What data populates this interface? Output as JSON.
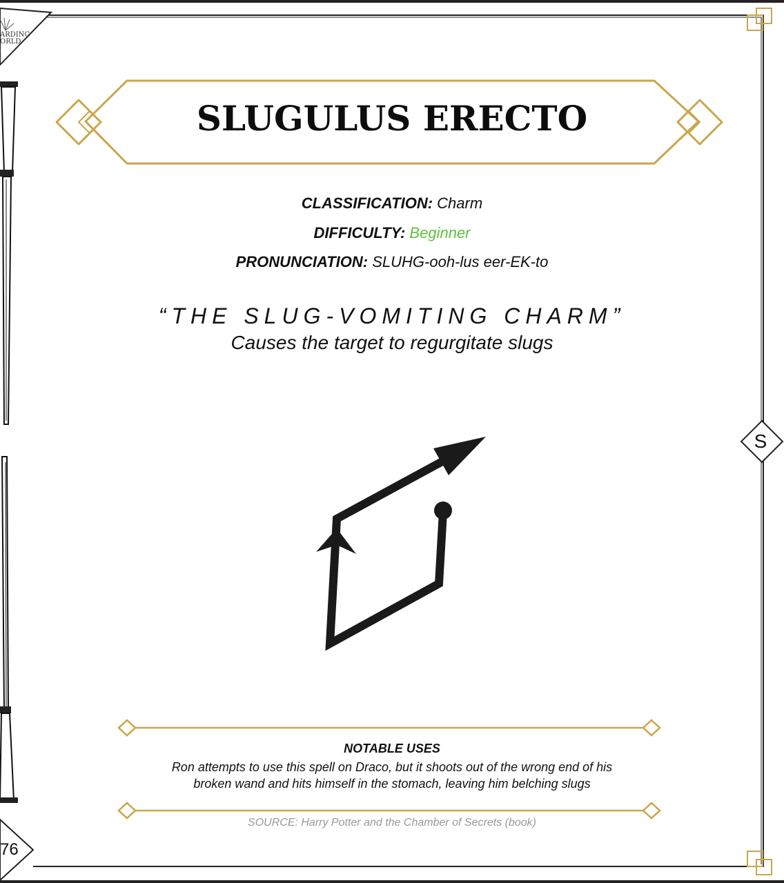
{
  "logo": {
    "line1": "ARDING",
    "line2": "ORLD"
  },
  "page_number": "76",
  "section_tab": "S",
  "spell": {
    "title": "SLUGULUS ERECTO",
    "classification_label": "CLASSIFICATION:",
    "classification_value": "Charm",
    "difficulty_label": "DIFFICULTY:",
    "difficulty_value": "Beginner",
    "pronunciation_label": "PRONUNCIATION:",
    "pronunciation_value": "SLUHG-ooh-lus eer-EK-to",
    "nickname": "“THE SLUG-VOMITING CHARM”",
    "description": "Causes the target to regurgitate slugs"
  },
  "notable": {
    "heading": "NOTABLE USES",
    "text": "Ron attempts to use this spell on Draco, but it shoots out of the wrong end of his broken wand and hits himself in the stomach, leaving him belching slugs"
  },
  "source": "SOURCE: Harry Potter and the Chamber of Secrets (book)",
  "colors": {
    "gold": "#c9a64a",
    "ink": "#111111",
    "difficulty_green": "#5fbf3c",
    "source_gray": "#999999"
  },
  "icons": [
    "wizarding-world-logo",
    "wand-illustration",
    "wand-motion-diagram",
    "gold-diamond-ornament"
  ]
}
